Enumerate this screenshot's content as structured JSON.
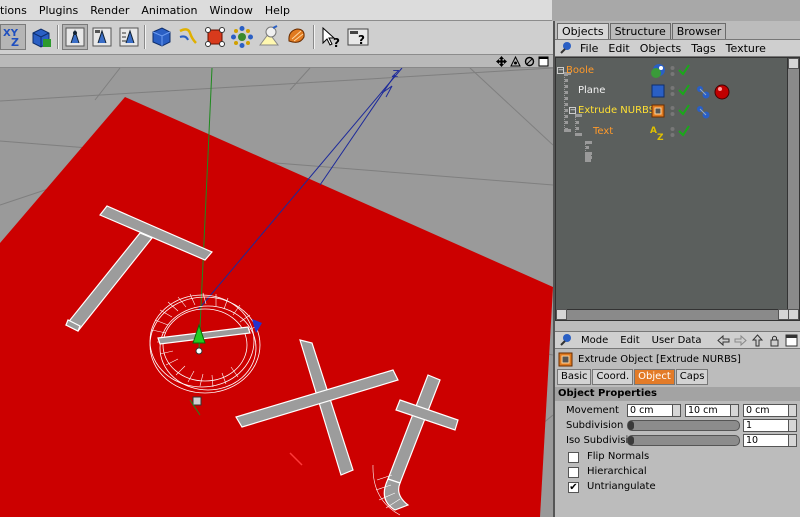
{
  "menubar": {
    "items": [
      "tions",
      "Plugins",
      "Render",
      "Animation",
      "Window",
      "Help"
    ]
  },
  "toolbar": {
    "icons": [
      "xyz-axis-toggle-icon",
      "cube-tool-icon",
      "render-view-icon",
      "render-picture-icon",
      "render-settings-icon",
      "cube-primitive-icon",
      "spline-icon",
      "nurbs-icon",
      "deformer-icon",
      "scene-icon",
      "light-icon",
      "material-icon",
      "pointer-help-icon",
      "cinema-help-icon"
    ]
  },
  "viewport": {
    "text_object": "Text",
    "nav_icons": [
      "move-view-icon",
      "rotate-view-icon",
      "zoom-view-icon",
      "maximize-view-icon"
    ],
    "colors": {
      "plane": "#cc0000",
      "background": "#9a9a9a",
      "grid": "#7f7f7f"
    }
  },
  "object_manager": {
    "tabs": [
      {
        "label": "Objects",
        "active": true
      },
      {
        "label": "Structure",
        "active": false
      },
      {
        "label": "Browser",
        "active": false
      }
    ],
    "menu": [
      "File",
      "Edit",
      "Objects",
      "Tags",
      "Texture"
    ],
    "objects": [
      {
        "name": "Boole",
        "depth": 0,
        "color": "orange",
        "icon": "boole-icon",
        "tags": []
      },
      {
        "name": "Plane",
        "depth": 1,
        "color": "white",
        "icon": "plane-icon",
        "tags": [
          "texture-tag-icon",
          "material-tag-icon"
        ]
      },
      {
        "name": "Extrude NURBS",
        "depth": 1,
        "color": "yellow",
        "icon": "extrude-nurbs-icon",
        "tags": [
          "texture-tag-icon"
        ]
      },
      {
        "name": "Text",
        "depth": 2,
        "color": "orange",
        "icon": "text-spline-icon",
        "tags": []
      }
    ]
  },
  "attribute_manager": {
    "menu": [
      "Mode",
      "Edit",
      "User Data"
    ],
    "title": "Extrude Object [Extrude NURBS]",
    "tabs": [
      {
        "label": "Basic",
        "active": false
      },
      {
        "label": "Coord.",
        "active": false
      },
      {
        "label": "Object",
        "active": true
      },
      {
        "label": "Caps",
        "active": false
      }
    ],
    "section": "Object Properties",
    "movement": {
      "label": "Movement",
      "x": "0 cm",
      "y": "10 cm",
      "z": "0 cm"
    },
    "subdivision": {
      "label": "Subdivision",
      "value": "1",
      "level": 0.05
    },
    "iso_subdivision": {
      "label": "Iso Subdivision",
      "value": "10",
      "level": 0.05
    },
    "options": [
      {
        "label": "Flip Normals",
        "checked": false
      },
      {
        "label": "Hierarchical",
        "checked": false
      },
      {
        "label": "Untriangulate",
        "checked": true
      }
    ]
  }
}
